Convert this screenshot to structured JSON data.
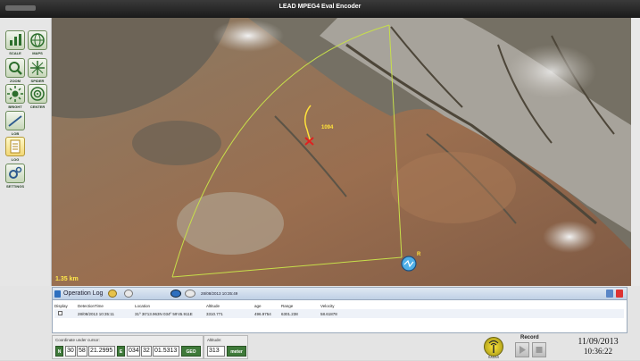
{
  "window": {
    "title": "LEAD MPEG4 Eval Encoder"
  },
  "toolbar": {
    "buttons": [
      {
        "label": "SCALE",
        "icon": "chart-icon"
      },
      {
        "label": "MAPS",
        "icon": "globe-icon"
      },
      {
        "label": "ZOOM AREA",
        "icon": "zoom-icon"
      },
      {
        "label": "SPIDER",
        "icon": "crosshair-icon"
      },
      {
        "label": "BRIGHT",
        "icon": "brightness-icon"
      },
      {
        "label": "CENTER",
        "icon": "center-icon"
      },
      {
        "label": "LOB",
        "icon": "line-icon"
      },
      {
        "label": "LOG",
        "icon": "document-icon"
      },
      {
        "label": "SETTINGS",
        "icon": "gears-icon"
      }
    ]
  },
  "map": {
    "scale_label": "1.35 km",
    "target_label": "1094",
    "sensor_label": "R"
  },
  "oplog": {
    "title": "Operation Log",
    "timestamp": "28/08/2013 10:35:49",
    "columns": [
      "Display",
      "DetectionTime",
      "Location",
      "Altitude",
      "age",
      "Range",
      "Velocity"
    ],
    "rows": [
      {
        "display": "",
        "time": "28/08/2013 10:35:11",
        "location": "31º 30'13.963N 034º 59'45.911E",
        "altitude": "3310.771",
        "age": "496.9754",
        "range": "6301.238",
        "velocity": "58.61878"
      }
    ]
  },
  "coords": {
    "label": "Coordinate under cursor:",
    "lat_hemi": "N",
    "lat_deg": "30",
    "lat_min": "58",
    "lat_sec": "21.2995",
    "lon_hemi": "E",
    "lon_deg": "034",
    "lon_min": "32",
    "lon_sec": "01.5313",
    "mode": "GEO"
  },
  "altitude": {
    "label": "Altitude:",
    "value": "313",
    "unit": "meter"
  },
  "record": {
    "label": "Record",
    "radio_label": "RADAR"
  },
  "clock": {
    "date": "11/09/2013",
    "time": "10:36:22"
  }
}
